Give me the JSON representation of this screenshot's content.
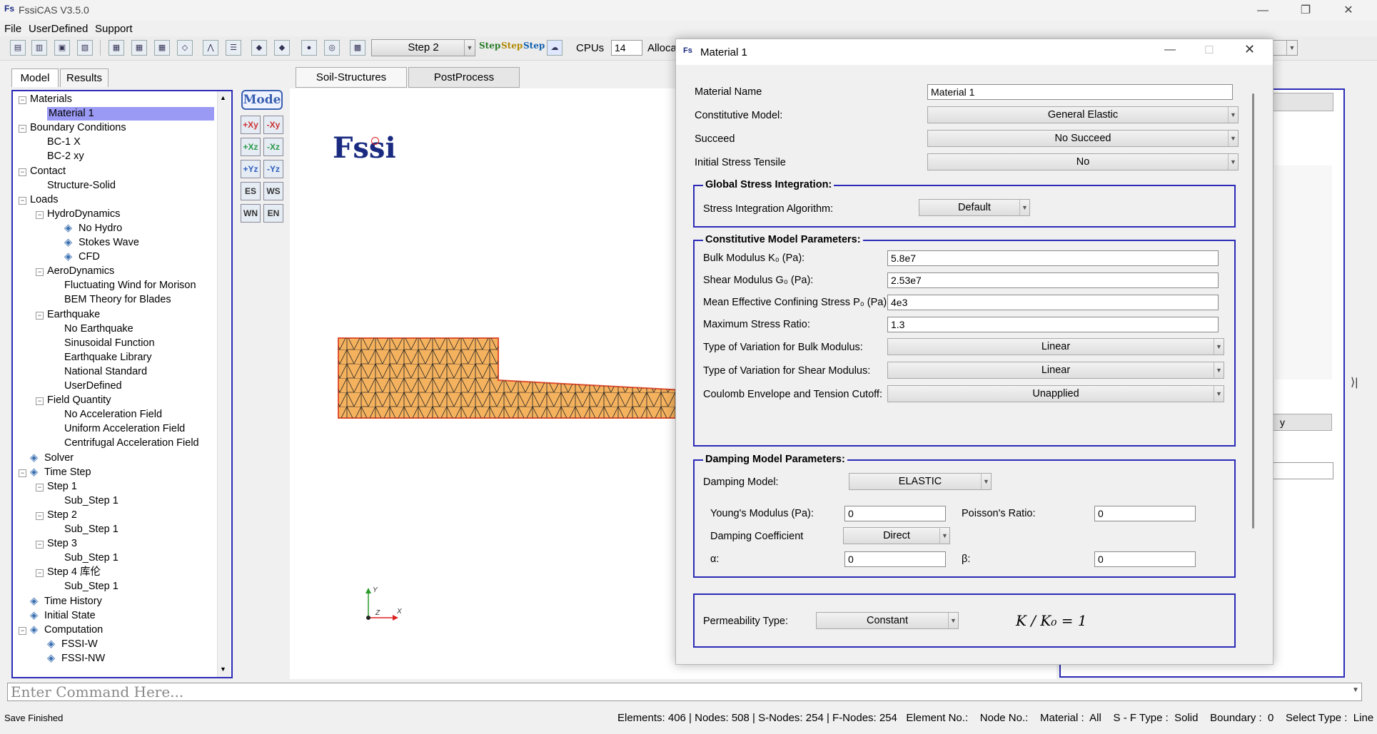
{
  "app": {
    "title": "FssiCAS V3.5.0"
  },
  "menu": [
    "File",
    "UserDefined",
    "Support"
  ],
  "toolbar": {
    "step_select": "Step 2",
    "step_buttons": [
      "Step",
      "Step",
      "Step"
    ],
    "cpus_label": "CPUs",
    "cpus_value": "14",
    "alloc_label": "Alloca"
  },
  "left_tabs": [
    "Model",
    "Results"
  ],
  "center_tabs": [
    "Soil-Structures",
    "PostProcess"
  ],
  "tree": [
    {
      "label": "Materials",
      "level": 0,
      "toggle": "-"
    },
    {
      "label": "Material 1",
      "level": 1,
      "selected": true
    },
    {
      "label": "Boundary Conditions",
      "level": 0,
      "toggle": "-"
    },
    {
      "label": "BC-1 X",
      "level": 1
    },
    {
      "label": "BC-2 xy",
      "level": 1
    },
    {
      "label": "Contact",
      "level": 0,
      "toggle": "-"
    },
    {
      "label": "Structure-Solid",
      "level": 1
    },
    {
      "label": "Loads",
      "level": 0,
      "toggle": "-"
    },
    {
      "label": "HydroDynamics",
      "level": 1,
      "toggle": "-"
    },
    {
      "label": "No Hydro",
      "level": 2,
      "icon": "hydro-icon"
    },
    {
      "label": "Stokes Wave",
      "level": 2,
      "icon": "wave-icon"
    },
    {
      "label": "CFD",
      "level": 2,
      "icon": "cfd-icon"
    },
    {
      "label": "AeroDynamics",
      "level": 1,
      "toggle": "-"
    },
    {
      "label": "Fluctuating Wind for Morison",
      "level": 2
    },
    {
      "label": "BEM Theory for Blades",
      "level": 2
    },
    {
      "label": "Earthquake",
      "level": 1,
      "toggle": "-"
    },
    {
      "label": "No Earthquake",
      "level": 2
    },
    {
      "label": "Sinusoidal Function",
      "level": 2
    },
    {
      "label": "Earthquake Library",
      "level": 2
    },
    {
      "label": "National Standard",
      "level": 2
    },
    {
      "label": "UserDefined",
      "level": 2
    },
    {
      "label": "Field Quantity",
      "level": 1,
      "toggle": "-"
    },
    {
      "label": "No Acceleration Field",
      "level": 2
    },
    {
      "label": "Uniform Acceleration Field",
      "level": 2
    },
    {
      "label": "Centrifugal Acceleration Field",
      "level": 2
    },
    {
      "label": "Solver",
      "level": 0,
      "icon": "wrench-icon"
    },
    {
      "label": "Time Step",
      "level": 0,
      "toggle": "-",
      "icon": "clock-icon"
    },
    {
      "label": "Step 1",
      "level": 1,
      "toggle": "-"
    },
    {
      "label": "Sub_Step 1",
      "level": 2
    },
    {
      "label": "Step 2",
      "level": 1,
      "toggle": "-"
    },
    {
      "label": "Sub_Step 1",
      "level": 2
    },
    {
      "label": "Step 3",
      "level": 1,
      "toggle": "-"
    },
    {
      "label": "Sub_Step 1",
      "level": 2
    },
    {
      "label": "Step 4 库伦",
      "level": 1,
      "toggle": "-"
    },
    {
      "label": "Sub_Step 1",
      "level": 2
    },
    {
      "label": "Time History",
      "level": 0,
      "icon": "history-icon"
    },
    {
      "label": "Initial State",
      "level": 0,
      "icon": "state-icon"
    },
    {
      "label": "Computation",
      "level": 0,
      "toggle": "-",
      "icon": "chip-icon"
    },
    {
      "label": "FSSI-W",
      "level": 1,
      "icon": "run-w-icon"
    },
    {
      "label": "FSSI-NW",
      "level": 1,
      "icon": "run-nw-icon"
    }
  ],
  "viewport": {
    "mode_button": "Mode",
    "logo": "Fssi",
    "axes": [
      "Y",
      "Z",
      "X"
    ]
  },
  "view_buttons": [
    "+Xy",
    "-Xy",
    "+Xz",
    "-Xz",
    "+Yz",
    "-Yz",
    "ES",
    "WS",
    "WN",
    "EN"
  ],
  "dialog": {
    "title": "Material 1",
    "material_name_label": "Material Name",
    "material_name_value": "Material 1",
    "constitutive_label": "Constitutive Model:",
    "constitutive_value": "General Elastic",
    "succeed_label": "Succeed",
    "succeed_value": "No Succeed",
    "tensile_label": "Initial Stress Tensile",
    "tensile_value": "No",
    "global": {
      "title": "Global Stress Integration:",
      "algo_label": "Stress Integration Algorithm:",
      "algo_value": "Default"
    },
    "params": {
      "title": "Constitutive Model Parameters:",
      "bulk_label": "Bulk Modulus K₀ (Pa):",
      "bulk_value": "5.8e7",
      "shear_label": "Shear Modulus G₀ (Pa):",
      "shear_value": "2.53e7",
      "mean_label": "Mean Effective Confining Stress P₀ (Pa):",
      "mean_value": "4e3",
      "ratio_label": "Maximum Stress Ratio:",
      "ratio_value": "1.3",
      "bulk_var_label": "Type of Variation for Bulk Modulus:",
      "bulk_var_value": "Linear",
      "shear_var_label": "Type of Variation for Shear Modulus:",
      "shear_var_value": "Linear",
      "coulomb_label": "Coulomb Envelope and Tension Cutoff:",
      "coulomb_value": "Unapplied"
    },
    "damping": {
      "title": "Damping Model Parameters:",
      "model_label": "Damping Model:",
      "model_value": "ELASTIC",
      "young_label": "Young's Modulus (Pa):",
      "young_value": "0",
      "poisson_label": "Poisson's Ratio:",
      "poisson_value": "0",
      "coef_label": "Damping Coefficient",
      "coef_value": "Direct",
      "alpha_label": "α:",
      "alpha_value": "0",
      "beta_label": "β:",
      "beta_value": "0"
    },
    "perm": {
      "label": "Permeability Type:",
      "value": "Constant",
      "formula": "K / K₀ = 1"
    }
  },
  "right_panel": {
    "button_fragment": "y"
  },
  "command": {
    "placeholder": "Enter Command Here..."
  },
  "status": {
    "left": "Save Finished",
    "right": "Elements: 406 | Nodes: 508 | S-Nodes: 254 | F-Nodes: 254   Element No.:    Node No.:    Material :  All    S - F Type :  Solid    Boundary :  0    Select Type :  Line"
  },
  "colors": {
    "accent_border": "#2b2bb8",
    "selection": "#9a9af5",
    "mesh_fill": "#f5b25e",
    "mesh_edge": "#e05030"
  }
}
